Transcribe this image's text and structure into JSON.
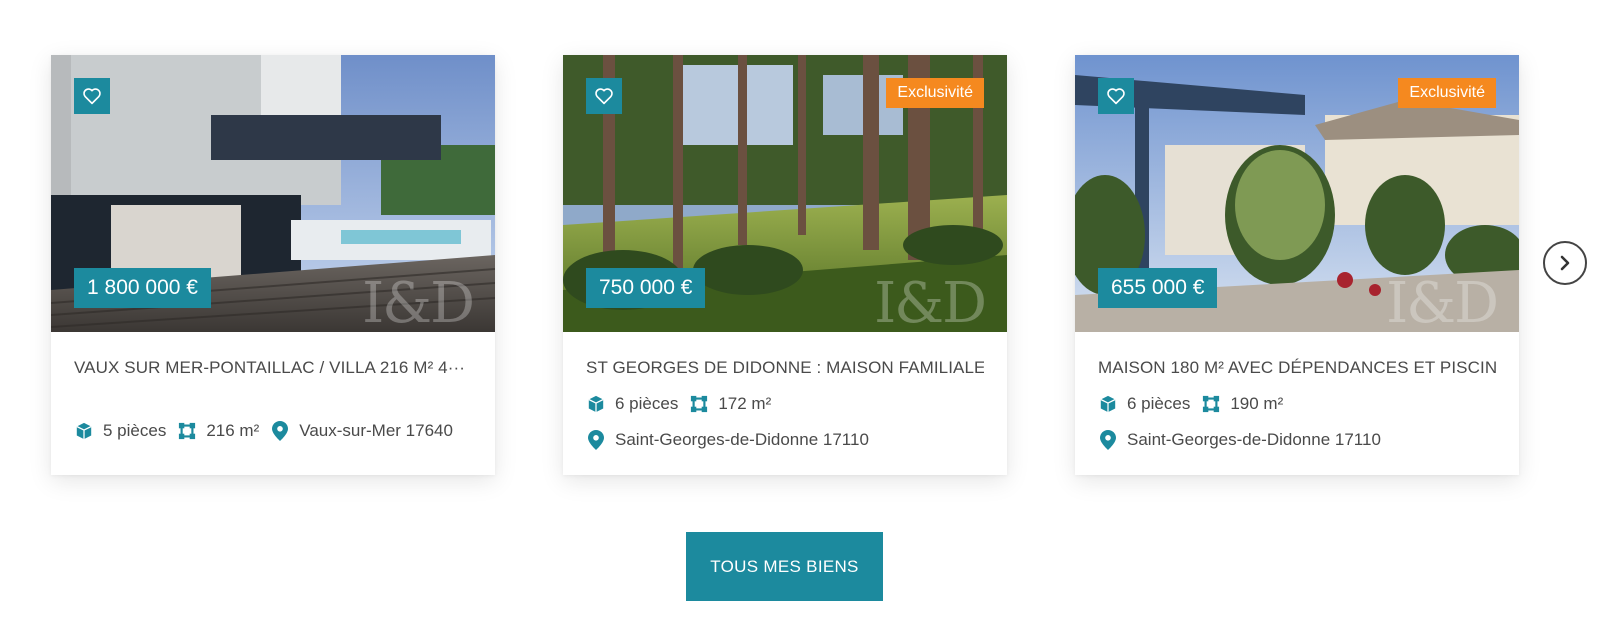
{
  "listings": [
    {
      "price": "1 800 000 €",
      "title": "VAUX SUR MER-PONTAILLAC / VILLA 216 M² 4···",
      "rooms": "5 pièces",
      "area": "216 m²",
      "location": "Vaux-sur-Mer 17640",
      "watermark": "I&D"
    },
    {
      "badge": "Exclusivité",
      "price": "750 000 €",
      "title": "ST GEORGES DE DIDONNE : MAISON FAMILIALE···",
      "rooms": "6 pièces",
      "area": "172 m²",
      "location": "Saint-Georges-de-Didonne 17110",
      "watermark": "I&D"
    },
    {
      "badge": "Exclusivité",
      "price": "655 000 €",
      "title": "MAISON 180 M² AVEC DÉPENDANCES ET PISCIN···",
      "rooms": "6 pièces",
      "area": "190 m²",
      "location": "Saint-Georges-de-Didonne 17110",
      "watermark": "I&D"
    }
  ],
  "cta": {
    "label": "TOUS MES BIENS"
  },
  "icons": {
    "favorite": "heart-icon",
    "rooms": "cube-icon",
    "area": "surface-icon",
    "location": "map-pin-icon",
    "next": "chevron-right-icon"
  },
  "colors": {
    "accent": "#1c8a9e",
    "badge": "#f5891f",
    "text": "#4a4a4a"
  }
}
